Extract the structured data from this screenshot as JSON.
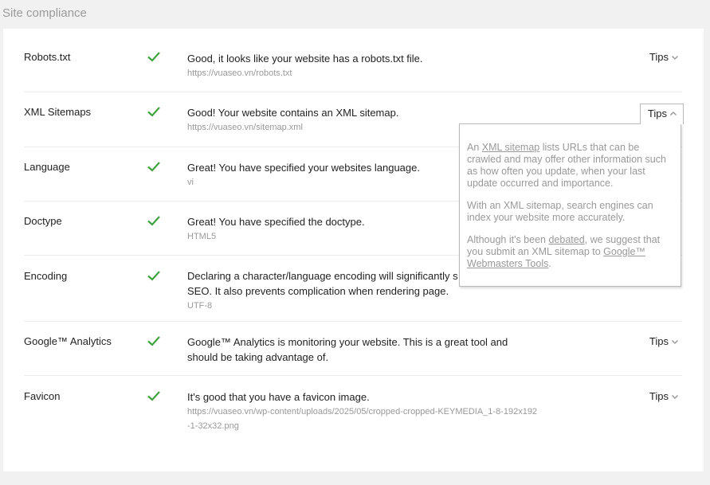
{
  "section": {
    "title": "Site compliance"
  },
  "tips_label": "Tips",
  "rows": [
    {
      "label": "Robots.txt",
      "message": "Good, it looks like your website has a robots.txt file.",
      "detail": "https://vuaseo.vn/robots.txt",
      "has_tips": true
    },
    {
      "label": "XML Sitemaps",
      "message": "Good! Your website contains an XML sitemap.",
      "detail": "https://vuaseo.vn/sitemap.xml",
      "has_tips": true,
      "tips_open": true
    },
    {
      "label": "Language",
      "message": "Great! You have specified your websites language.",
      "detail": "vi"
    },
    {
      "label": "Doctype",
      "message": "Great! You have specified the doctype.",
      "detail": "HTML5"
    },
    {
      "label": "Encoding",
      "message_line1": "Declaring a character/language encoding will significantly s",
      "message_line2": "SEO. It also prevents complication when rendering page.",
      "detail": "UTF-8"
    },
    {
      "label": "Google™ Analytics",
      "message": "Google™ Analytics is monitoring your website. This is a great tool and should be taking advantage of.",
      "has_tips": true
    },
    {
      "label": "Favicon",
      "message": "It's good that you have a favicon image.",
      "detail": "https://vuaseo.vn/wp-content/uploads/2025/05/cropped-cropped-KEYMEDIA_1-8-192x192-1-32x32.png",
      "has_tips": true
    }
  ],
  "popover": {
    "p1_pre": "An ",
    "p1_link": "XML sitemap",
    "p1_post": " lists URLs that can be crawled and may offer other information such as how often you update, when your last update occurred and importance.",
    "p2": "With an XML sitemap, search engines can index your website more accurately.",
    "p3_pre": "Although it's been ",
    "p3_link1": "debated",
    "p3_mid": ", we suggest that you submit an XML sitemap to ",
    "p3_link2": "Google™ Webmasters Tools",
    "p3_post": "."
  },
  "colors": {
    "check": "#3ea33e",
    "chevron": "#9a9a9a"
  }
}
